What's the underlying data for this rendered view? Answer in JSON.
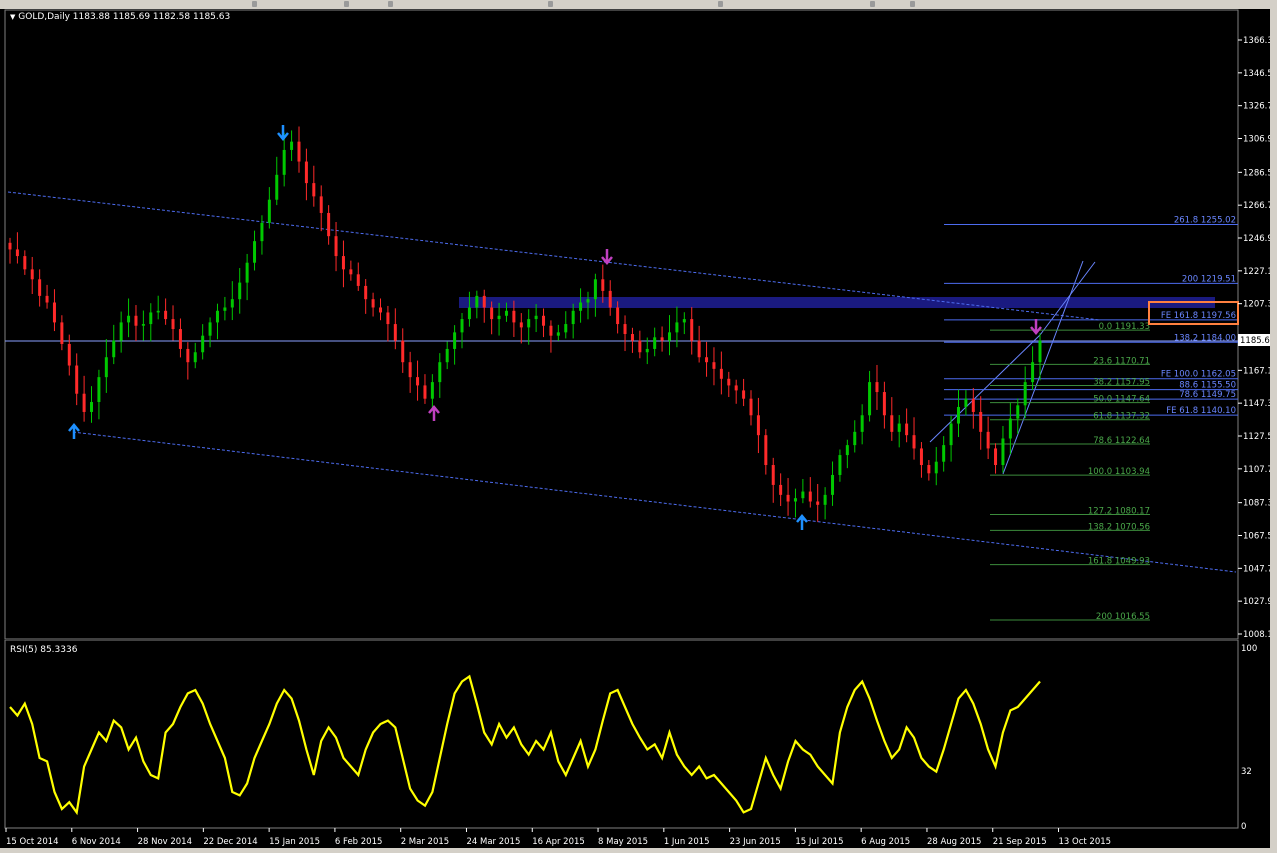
{
  "window": {
    "symbol_header": "GOLD,Daily  1183.88 1185.69 1182.58 1185.63",
    "rsi_header": "RSI(5) 85.3336"
  },
  "colors": {
    "background": "#000000",
    "bull": "#00c800",
    "bear": "#ff2a2a",
    "rsi": "#ffff00",
    "fib_blue": "#4d6cf0",
    "fib_green": "#3c8c3c",
    "zone": "#1a1a80",
    "highlight_box": "#ff8040",
    "arrow_blue": "#1e90ff",
    "arrow_magenta": "#c040c0"
  },
  "price_axis": {
    "ticks": [
      "1366.30",
      "1346.50",
      "1326.70",
      "1306.90",
      "1286.50",
      "1266.70",
      "1246.90",
      "1227.10",
      "1207.30",
      "1185.63",
      "1167.10",
      "1147.30",
      "1127.50",
      "1107.70",
      "1087.30",
      "1067.50",
      "1047.70",
      "1027.90",
      "1008.10"
    ],
    "current_price": "1185.63"
  },
  "time_axis": {
    "labels": [
      "15 Oct 2014",
      "6 Nov 2014",
      "28 Nov 2014",
      "22 Dec 2014",
      "15 Jan 2015",
      "6 Feb 2015",
      "2 Mar 2015",
      "24 Mar 2015",
      "16 Apr 2015",
      "8 May 2015",
      "1 Jun 2015",
      "23 Jun 2015",
      "15 Jul 2015",
      "6 Aug 2015",
      "28 Aug 2015",
      "21 Sep 2015",
      "13 Oct 2015"
    ]
  },
  "rsi_axis": {
    "ticks": [
      "100",
      "32",
      "0"
    ]
  },
  "fib_blue_labels": [
    {
      "text": "261.8  1255.02",
      "price": 1255.02
    },
    {
      "text": "200  1219.51",
      "price": 1219.51
    },
    {
      "text": "FE 161.8  1197.56",
      "price": 1197.56
    },
    {
      "text": "138.2  1184.00",
      "price": 1184.0
    },
    {
      "text": "FE 100.0  1162.05",
      "price": 1162.05
    },
    {
      "text": "88.6  1155.50",
      "price": 1155.5
    },
    {
      "text": "78.6  1149.75",
      "price": 1149.75
    },
    {
      "text": "FE 61.8  1140.10",
      "price": 1140.1
    }
  ],
  "fib_green_labels": [
    {
      "text": "0.0  1191.33",
      "price": 1191.33
    },
    {
      "text": "23.6  1170.71",
      "price": 1170.71
    },
    {
      "text": "38.2  1157.95",
      "price": 1157.95
    },
    {
      "text": "50.0  1147.64",
      "price": 1147.64
    },
    {
      "text": "61.8  1137.32",
      "price": 1137.32
    },
    {
      "text": "78.6  1122.64",
      "price": 1122.64
    },
    {
      "text": "100.0  1103.94",
      "price": 1103.94
    },
    {
      "text": "127.2  1080.17",
      "price": 1080.17
    },
    {
      "text": "138.2  1070.56",
      "price": 1070.56
    },
    {
      "text": "161.8  1049.93",
      "price": 1049.93
    },
    {
      "text": "200  1016.55",
      "price": 1016.55
    }
  ],
  "chart_data": {
    "type": "candlestick",
    "symbol": "GOLD",
    "timeframe": "Daily",
    "last": {
      "open": 1183.88,
      "high": 1185.69,
      "low": 1182.58,
      "close": 1185.63
    },
    "y_range": [
      1000,
      1380
    ],
    "closes_approx": [
      1240,
      1236,
      1228,
      1222,
      1212,
      1208,
      1196,
      1183,
      1170,
      1153,
      1142,
      1148,
      1163,
      1175,
      1185,
      1196,
      1200,
      1194,
      1195,
      1202,
      1203,
      1198,
      1192,
      1180,
      1172,
      1178,
      1188,
      1196,
      1203,
      1205,
      1210,
      1220,
      1232,
      1245,
      1256,
      1270,
      1285,
      1300,
      1305,
      1293,
      1280,
      1272,
      1262,
      1248,
      1236,
      1228,
      1225,
      1218,
      1210,
      1205,
      1202,
      1195,
      1185,
      1172,
      1163,
      1158,
      1150,
      1160,
      1172,
      1180,
      1190,
      1198,
      1205,
      1212,
      1205,
      1198,
      1200,
      1203,
      1196,
      1193,
      1198,
      1200,
      1194,
      1188,
      1190,
      1195,
      1203,
      1208,
      1210,
      1222,
      1215,
      1205,
      1195,
      1189,
      1185,
      1178,
      1180,
      1187,
      1185,
      1190,
      1196,
      1198,
      1185,
      1175,
      1172,
      1168,
      1162,
      1158,
      1155,
      1150,
      1140,
      1128,
      1110,
      1098,
      1092,
      1088,
      1090,
      1094,
      1088,
      1086,
      1092,
      1104,
      1116,
      1122,
      1130,
      1140,
      1160,
      1154,
      1140,
      1130,
      1135,
      1128,
      1120,
      1110,
      1105,
      1112,
      1122,
      1135,
      1145,
      1150,
      1142,
      1130,
      1120,
      1110,
      1126,
      1138,
      1146,
      1160,
      1172,
      1185
    ]
  }
}
